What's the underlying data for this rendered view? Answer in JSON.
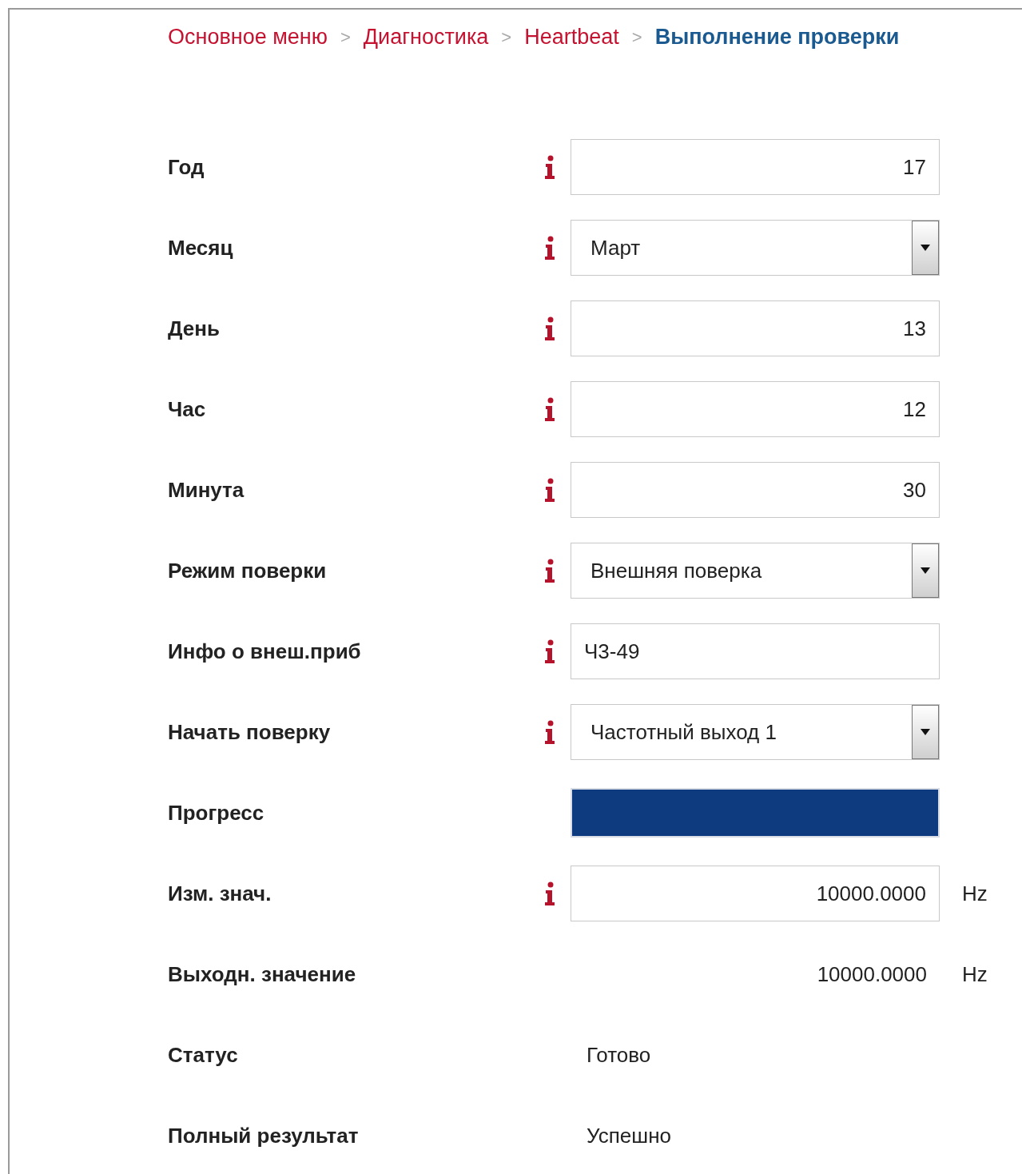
{
  "breadcrumb": [
    {
      "label": "Основное меню",
      "selected": false
    },
    {
      "label": "Диагностика",
      "selected": false
    },
    {
      "label": "Heartbeat",
      "selected": false
    },
    {
      "label": "Выполнение проверки",
      "selected": true
    }
  ],
  "separator": ">",
  "rows": [
    {
      "kind": "number",
      "label": "Год",
      "info": true,
      "value": "17"
    },
    {
      "kind": "select",
      "label": "Месяц",
      "info": true,
      "value": "Март"
    },
    {
      "kind": "number",
      "label": "День",
      "info": true,
      "value": "13"
    },
    {
      "kind": "number",
      "label": "Час",
      "info": true,
      "value": "12"
    },
    {
      "kind": "number",
      "label": "Минута",
      "info": true,
      "value": "30"
    },
    {
      "kind": "select",
      "label": "Режим поверки",
      "info": true,
      "value": "Внешняя поверка"
    },
    {
      "kind": "text",
      "label": "Инфо о внеш.приб",
      "info": true,
      "value": "Ч3-49"
    },
    {
      "kind": "select",
      "label": "Начать поверку",
      "info": true,
      "value": "Частотный выход 1"
    },
    {
      "kind": "progress",
      "label": "Прогресс",
      "info": false,
      "level": 1
    },
    {
      "kind": "number",
      "label": "Изм. знач.",
      "info": true,
      "value": "10000.0000",
      "unit": "Hz"
    },
    {
      "kind": "readout",
      "label": "Выходн. значение",
      "info": false,
      "value": "10000.0000",
      "unit": "Hz"
    },
    {
      "kind": "status",
      "label": "Статус",
      "info": false,
      "value": "Готово"
    },
    {
      "kind": "status",
      "label": "Полный результат",
      "info": false,
      "value": "Успешно"
    }
  ]
}
